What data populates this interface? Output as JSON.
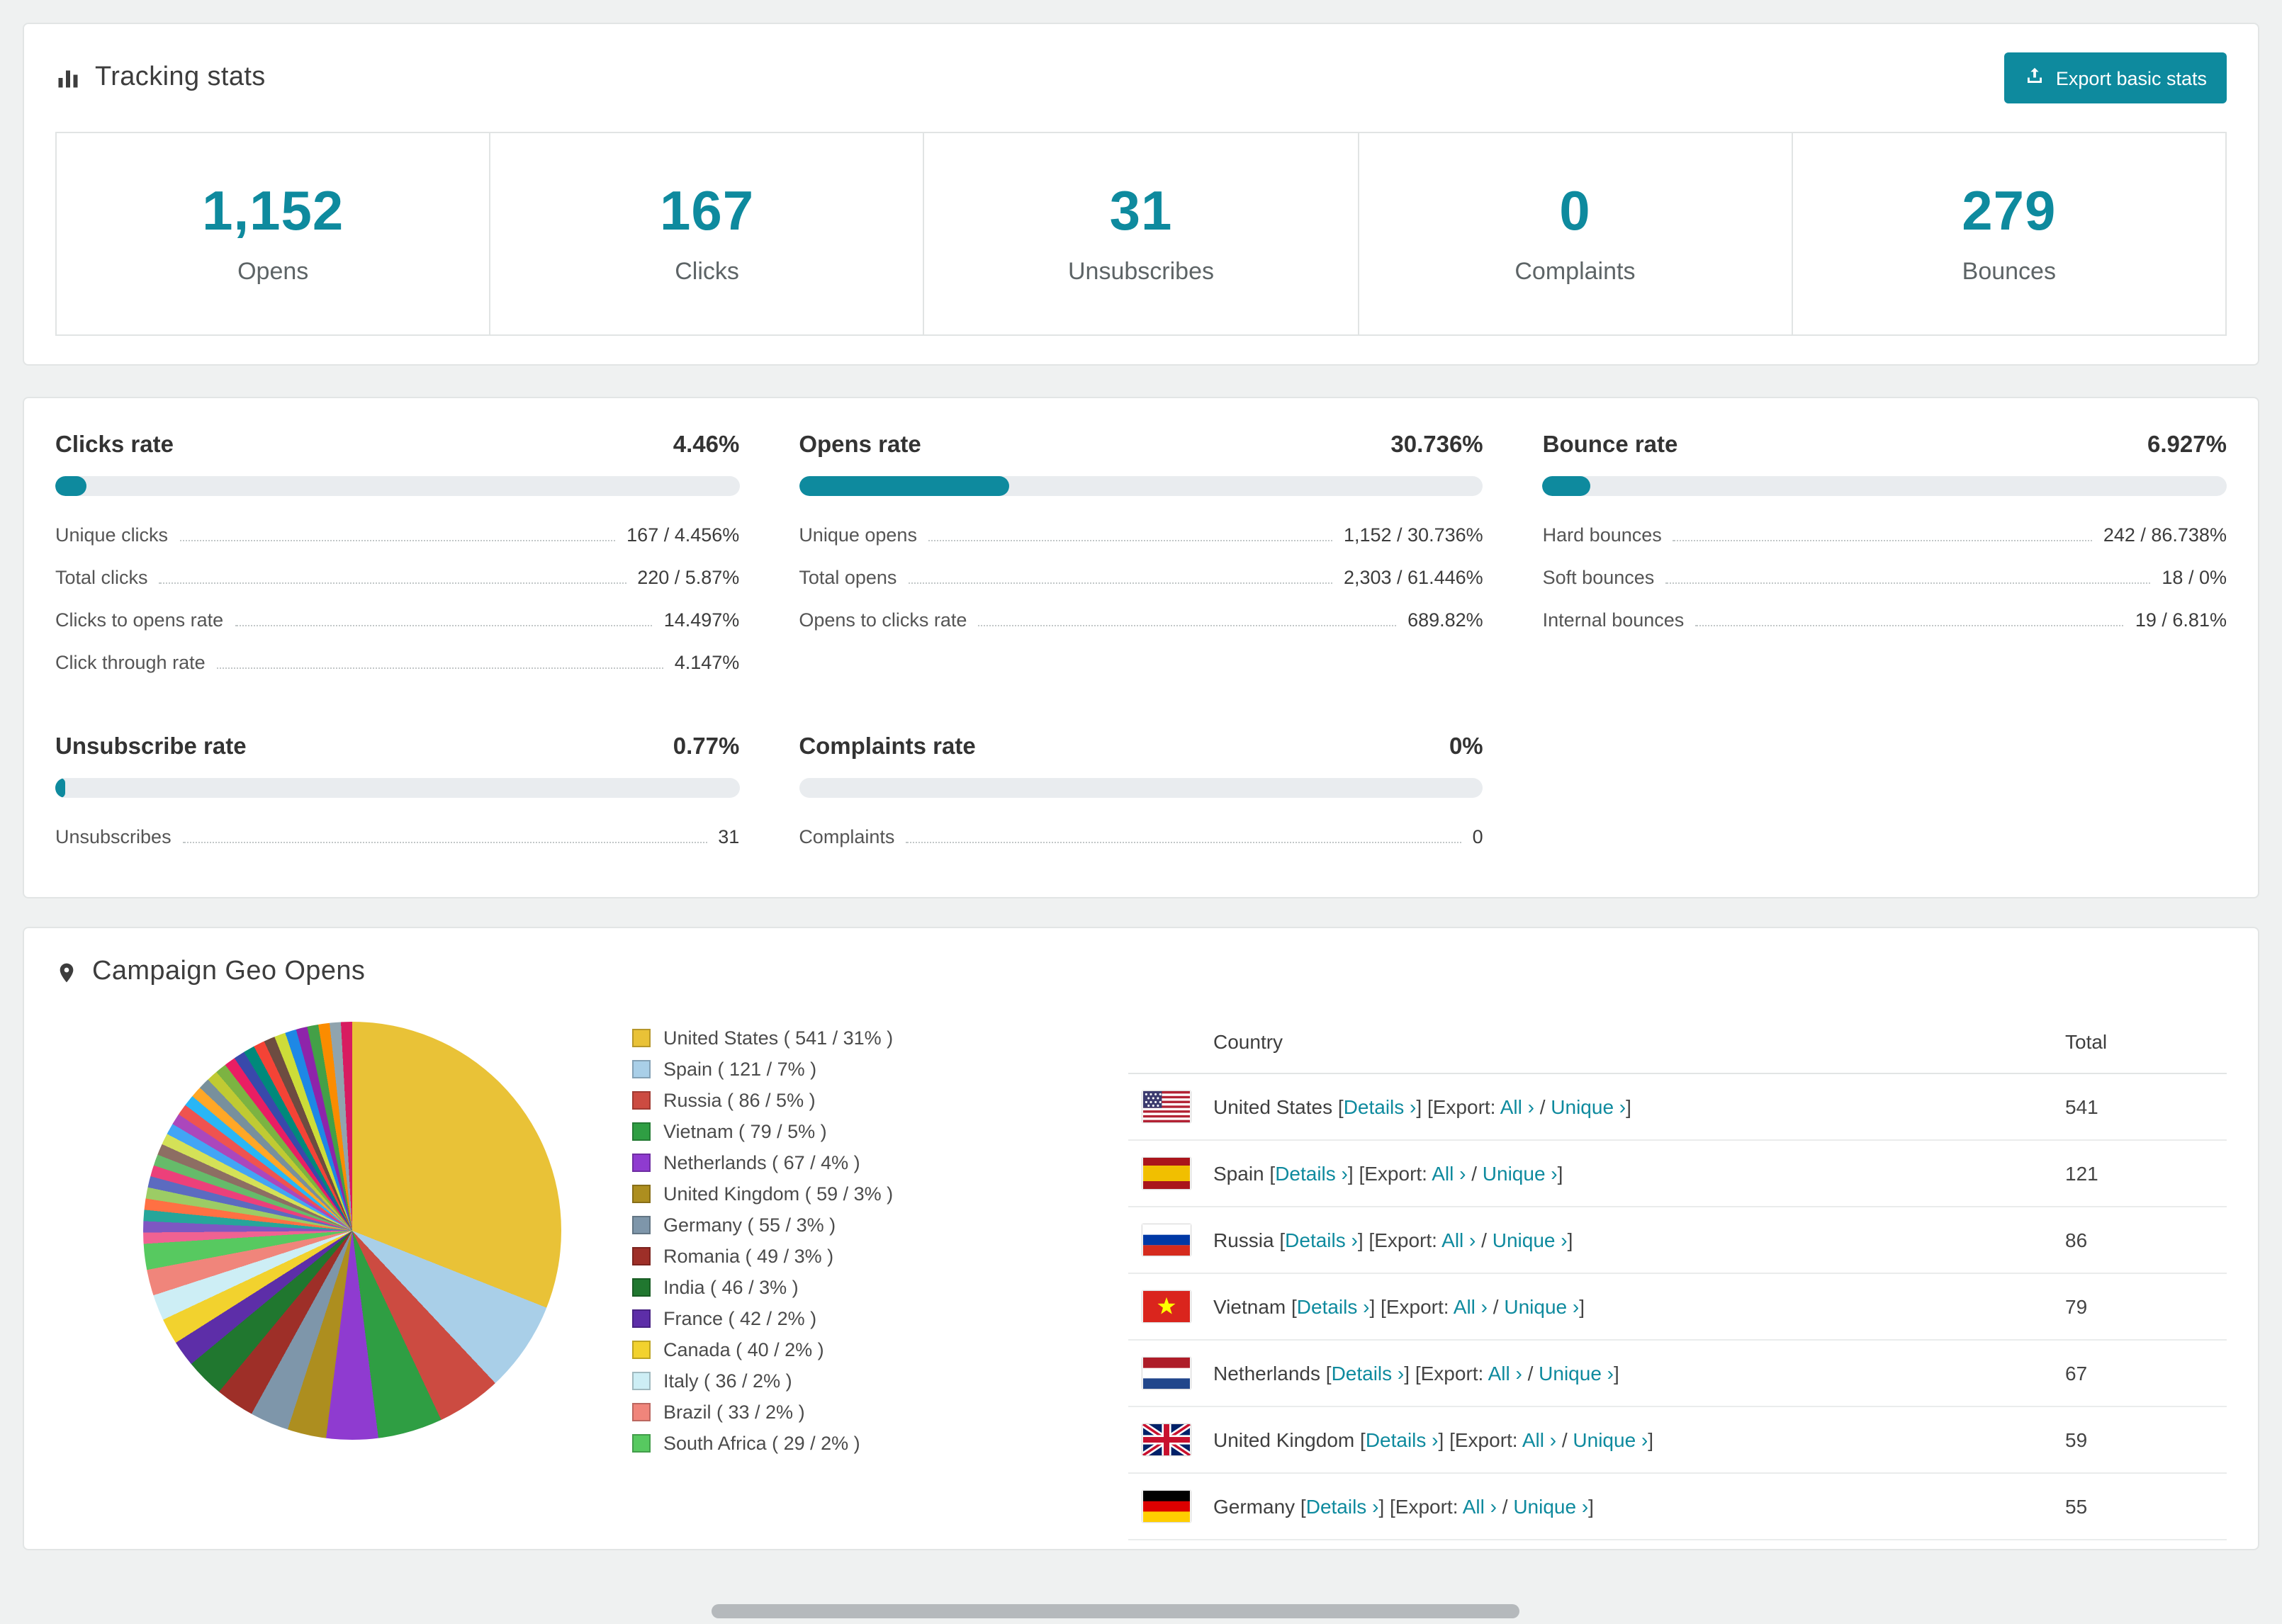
{
  "accent": "#0e8a9e",
  "header": {
    "title": "Tracking stats",
    "export_label": "Export basic stats"
  },
  "summary_stats": [
    {
      "value": "1,152",
      "label": "Opens"
    },
    {
      "value": "167",
      "label": "Clicks"
    },
    {
      "value": "31",
      "label": "Unsubscribes"
    },
    {
      "value": "0",
      "label": "Complaints"
    },
    {
      "value": "279",
      "label": "Bounces"
    }
  ],
  "rates": [
    {
      "title": "Clicks rate",
      "value": "4.46%",
      "percent": 4.46,
      "rows": [
        {
          "label": "Unique clicks",
          "value": "167 / 4.456%"
        },
        {
          "label": "Total clicks",
          "value": "220 / 5.87%"
        },
        {
          "label": "Clicks to opens rate",
          "value": "14.497%"
        },
        {
          "label": "Click through rate",
          "value": "4.147%"
        }
      ]
    },
    {
      "title": "Opens rate",
      "value": "30.736%",
      "percent": 30.736,
      "rows": [
        {
          "label": "Unique opens",
          "value": "1,152 / 30.736%"
        },
        {
          "label": "Total opens",
          "value": "2,303 / 61.446%"
        },
        {
          "label": "Opens to clicks rate",
          "value": "689.82%"
        }
      ]
    },
    {
      "title": "Bounce rate",
      "value": "6.927%",
      "percent": 6.927,
      "rows": [
        {
          "label": "Hard bounces",
          "value": "242 / 86.738%"
        },
        {
          "label": "Soft bounces",
          "value": "18 / 0%"
        },
        {
          "label": "Internal bounces",
          "value": "19 / 6.81%"
        }
      ]
    },
    {
      "title": "Unsubscribe rate",
      "value": "0.77%",
      "percent": 0.77,
      "rows": [
        {
          "label": "Unsubscribes",
          "value": "31"
        }
      ]
    },
    {
      "title": "Complaints rate",
      "value": "0%",
      "percent": 0,
      "rows": [
        {
          "label": "Complaints",
          "value": "0"
        }
      ]
    }
  ],
  "geo": {
    "title": "Campaign Geo Opens",
    "table": {
      "columns": [
        "Country",
        "Total"
      ],
      "labels": {
        "bracket_open": "[",
        "bracket_close": "]",
        "details": "Details ›",
        "export_prefix": "Export:",
        "all": "All ›",
        "unique": "Unique ›",
        "separator": " / "
      },
      "rows": [
        {
          "country": "United States",
          "flag": "us",
          "total": "541"
        },
        {
          "country": "Spain",
          "flag": "es",
          "total": "121"
        },
        {
          "country": "Russia",
          "flag": "ru",
          "total": "86"
        },
        {
          "country": "Vietnam",
          "flag": "vn",
          "total": "79"
        },
        {
          "country": "Netherlands",
          "flag": "nl",
          "total": "67"
        },
        {
          "country": "United Kingdom",
          "flag": "gb",
          "total": "59"
        },
        {
          "country": "Germany",
          "flag": "de",
          "total": "55"
        }
      ]
    }
  },
  "chart_data": {
    "type": "pie",
    "title": "Campaign Geo Opens",
    "legend_position": "right",
    "slices": [
      {
        "label": "United States",
        "value": 541,
        "percent": 31,
        "color": "#e9c237"
      },
      {
        "label": "Spain",
        "value": 121,
        "percent": 7,
        "color": "#a9cfe8"
      },
      {
        "label": "Russia",
        "value": 86,
        "percent": 5,
        "color": "#cc4b41"
      },
      {
        "label": "Vietnam",
        "value": 79,
        "percent": 5,
        "color": "#2f9e43"
      },
      {
        "label": "Netherlands",
        "value": 67,
        "percent": 4,
        "color": "#8f3bd0"
      },
      {
        "label": "United Kingdom",
        "value": 59,
        "percent": 3,
        "color": "#ad8e1f"
      },
      {
        "label": "Germany",
        "value": 55,
        "percent": 3,
        "color": "#7e96aa"
      },
      {
        "label": "Romania",
        "value": 49,
        "percent": 3,
        "color": "#9e2f28"
      },
      {
        "label": "India",
        "value": 46,
        "percent": 3,
        "color": "#20772f"
      },
      {
        "label": "France",
        "value": 42,
        "percent": 2,
        "color": "#5d2ea8"
      },
      {
        "label": "Canada",
        "value": 40,
        "percent": 2,
        "color": "#f2d22e"
      },
      {
        "label": "Italy",
        "value": 36,
        "percent": 2,
        "color": "#cdeef5"
      },
      {
        "label": "Brazil",
        "value": 33,
        "percent": 2,
        "color": "#f0857b"
      },
      {
        "label": "South Africa",
        "value": 29,
        "percent": 2,
        "color": "#57c960"
      }
    ],
    "others_percent": 26,
    "others_colors": [
      "#f06292",
      "#7e57c2",
      "#26a69a",
      "#ff7043",
      "#9ccc65",
      "#5c6bc0",
      "#ec407a",
      "#66bb6a",
      "#8d6e63",
      "#d4e157",
      "#42a5f5",
      "#ab47bc",
      "#ef5350",
      "#29b6f6",
      "#ffa726",
      "#78909c",
      "#c0ca33",
      "#7cb342",
      "#e91e63",
      "#3949ab",
      "#00897b",
      "#f44336",
      "#6d4c41",
      "#cddc39",
      "#1e88e5",
      "#8e24aa",
      "#43a047",
      "#fb8c00",
      "#90a4ae",
      "#d81b60"
    ]
  }
}
